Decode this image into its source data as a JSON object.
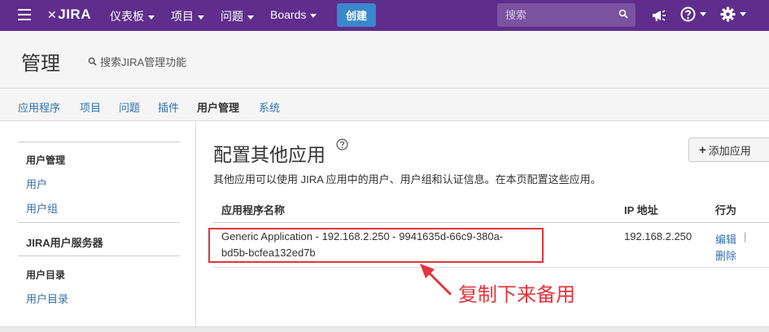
{
  "topbar": {
    "logo": "JIRA",
    "nav": [
      "仪表板",
      "项目",
      "问题",
      "Boards"
    ],
    "create": "创建",
    "search_placeholder": "搜索"
  },
  "header": {
    "title": "管理",
    "admin_search": "搜索JIRA管理功能"
  },
  "tabs": [
    "应用程序",
    "项目",
    "问题",
    "插件",
    "用户管理",
    "系统"
  ],
  "active_tab": "用户管理",
  "sidebar": {
    "section1_head": "用户管理",
    "users": "用户",
    "groups": "用户组",
    "jira_server": "JIRA用户服务器",
    "section2_head": "用户目录",
    "directories": "用户目录"
  },
  "main": {
    "title": "配置其他应用",
    "add_button": "添加应用",
    "description": "其他应用可以使用 JIRA 应用中的用户、用户组和认证信息。在本页配置这些应用。",
    "table": {
      "headers": [
        "应用程序名称",
        "IP 地址",
        "行为"
      ],
      "rows": [
        {
          "name_line1": "Generic Application - 192.168.2.250 - 9941635d-66c9-380a-",
          "name_line2": "bd5b-bcfea132ed7b",
          "ip": "192.168.2.250",
          "edit": "编辑",
          "sep": "|",
          "delete": "删除"
        }
      ]
    }
  },
  "annotation": "复制下来备用",
  "colors": {
    "topbar": "#5f2d8c",
    "create": "#3b87cc",
    "link": "#3572b0",
    "annotation": "#e2353c"
  }
}
